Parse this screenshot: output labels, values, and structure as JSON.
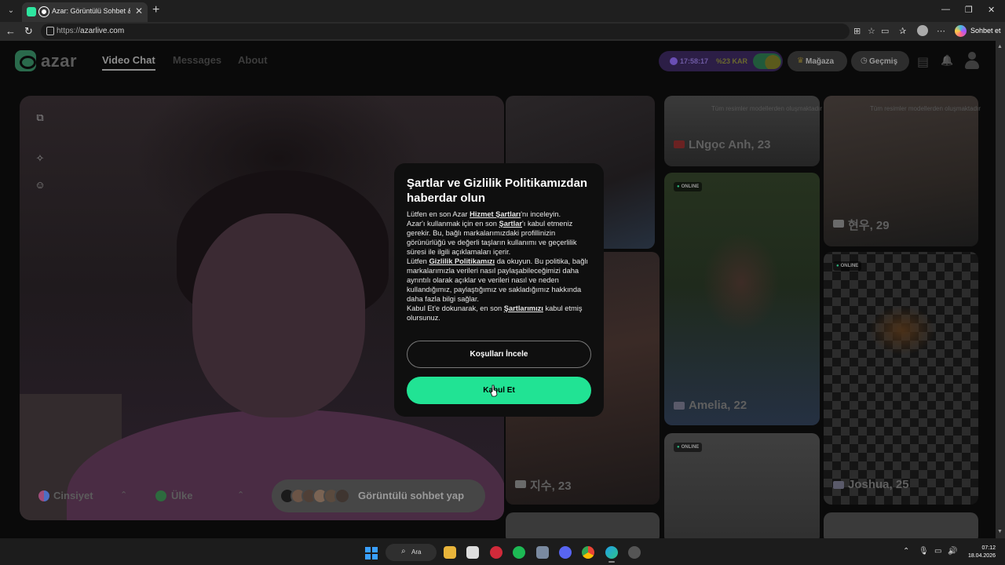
{
  "browser": {
    "tab_title": "Azar: Görüntülü Sohbet & Yeni",
    "tab_close": "✕",
    "new_tab": "+",
    "tab_menu": "⌄",
    "min": "—",
    "max": "❐",
    "close": "✕",
    "back": "←",
    "reload": "↻",
    "url_scheme": "https://",
    "url_host": "azarlive.com",
    "toolbar_icons": [
      "⊞",
      "☆",
      "▭",
      "✰",
      "⋯"
    ],
    "copilot_label": "Sohbet et"
  },
  "header": {
    "logo_text": "azar",
    "nav": [
      {
        "label": "Video Chat",
        "active": true
      },
      {
        "label": "Messages",
        "active": false
      },
      {
        "label": "About",
        "active": false
      }
    ],
    "promo_timer": "17:58:17",
    "promo_off": "%23 KAR",
    "store_label": "Mağaza",
    "store_icon": "♛",
    "history_label": "Geçmiş",
    "history_icon": "◷",
    "box_icon": "▤",
    "bell_icon": "🔔"
  },
  "camera_tools": [
    "⧉",
    "✧",
    "☺"
  ],
  "filters": {
    "gender": "Cinsiyet",
    "country": "Ülke",
    "chev": "⌃",
    "start_label": "Görüntülü sohbet yap"
  },
  "cards": {
    "caption": "Tüm resimler modellerden oluşmaktadır",
    "online": "ONLINE",
    "names": {
      "lngoc": "LNgọc Anh, 23",
      "hyeonu": "현우, 29",
      "amelia": "Amelia, 22",
      "jisu": "지수, 23",
      "joshua": "Joshua, 25"
    }
  },
  "dialog": {
    "title": "Şartlar ve Gizlilik Politikamızdan haberdar olun",
    "p1_a": "Lütfen en son Azar ",
    "p1_link": "Hizmet Şartları",
    "p1_b": "'nı inceleyin.",
    "p2_a": "Azar'ı kullanmak için en son ",
    "p2_link": "Şartlar",
    "p2_b": "'ı kabul etmeniz gerekir. Bu, bağlı markalarımızdaki profillinizin görünürlüğü ve değerli taşların kullanımı ve geçerlilik süresi ile ilgili açıklamaları içerir.",
    "p3_a": "Lütfen ",
    "p3_link": "Gizlilik Politikamızı",
    "p3_b": " da okuyun. Bu politika, bağlı markalarımızla verileri nasıl paylaşabileceğimizi daha ayrıntılı olarak açıklar ve verileri nasıl ve neden kullandığımız, paylaştığımız ve sakladığımız hakkında daha fazla bilgi sağlar.",
    "p4_a": "Kabul Et'e dokunarak, en son ",
    "p4_link": "Şartlarımızı",
    "p4_b": " kabul etmiş olursunuz.",
    "review_button": "Koşulları İncele",
    "accept_button": "Kabul Et"
  },
  "taskbar": {
    "search_label": "Ara",
    "search_icon": "⌕",
    "tray_icons": [
      "⌃",
      "🎙",
      "▭",
      "🔊"
    ],
    "time": "07:12",
    "date": "18.04.2026"
  }
}
